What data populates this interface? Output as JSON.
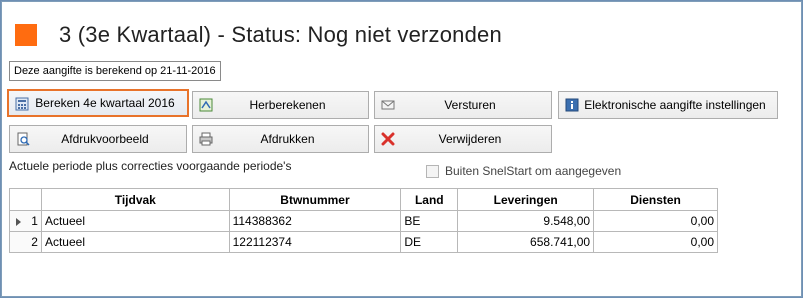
{
  "header": {
    "title": "3 (3e Kwartaal) - Status: Nog niet verzonden",
    "status_color": "#ff6c10"
  },
  "info": {
    "calculated_text": "Deze aangifte is berekend op 21-11-2016"
  },
  "buttons": {
    "bereken": "Bereken 4e kwartaal 2016",
    "herberekenen": "Herberekenen",
    "versturen": "Versturen",
    "elektronische": "Elektronische aangifte instellingen",
    "afdrukvoorbeeld": "Afdrukvoorbeeld",
    "afdrukken": "Afdrukken",
    "verwijderen": "Verwijderen"
  },
  "section": {
    "label": "Actuele periode plus correcties voorgaande periode's",
    "checkbox_label": "Buiten SnelStart om aangegeven",
    "checkbox_checked": false
  },
  "table": {
    "columns": [
      "Tijdvak",
      "Btwnummer",
      "Land",
      "Leveringen",
      "Diensten"
    ],
    "rows": [
      {
        "n": "1",
        "tijdvak": "Actueel",
        "btw": "114388362",
        "land": "BE",
        "leveringen": "9.548,00",
        "diensten": "0,00"
      },
      {
        "n": "2",
        "tijdvak": "Actueel",
        "btw": "122112374",
        "land": "DE",
        "leveringen": "658.741,00",
        "diensten": "0,00"
      }
    ]
  }
}
